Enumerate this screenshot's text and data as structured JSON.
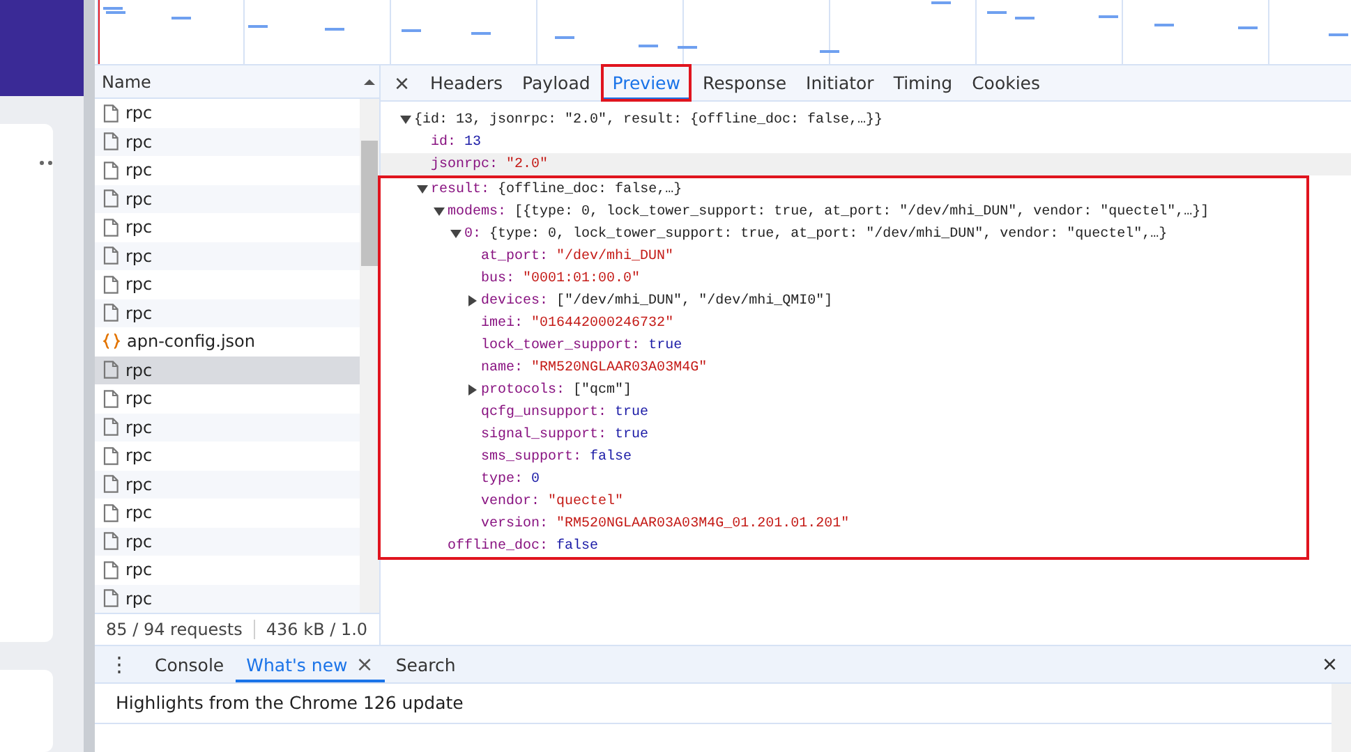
{
  "requests": {
    "column": "Name",
    "rows": [
      {
        "name": "rpc",
        "kind": "doc",
        "selected": false
      },
      {
        "name": "rpc",
        "kind": "doc",
        "selected": false
      },
      {
        "name": "rpc",
        "kind": "doc",
        "selected": false
      },
      {
        "name": "rpc",
        "kind": "doc",
        "selected": false
      },
      {
        "name": "rpc",
        "kind": "doc",
        "selected": false
      },
      {
        "name": "rpc",
        "kind": "doc",
        "selected": false
      },
      {
        "name": "rpc",
        "kind": "doc",
        "selected": false
      },
      {
        "name": "rpc",
        "kind": "doc",
        "selected": false
      },
      {
        "name": "apn-config.json",
        "kind": "json",
        "selected": false
      },
      {
        "name": "rpc",
        "kind": "doc",
        "selected": true
      },
      {
        "name": "rpc",
        "kind": "doc",
        "selected": false
      },
      {
        "name": "rpc",
        "kind": "doc",
        "selected": false
      },
      {
        "name": "rpc",
        "kind": "doc",
        "selected": false
      },
      {
        "name": "rpc",
        "kind": "doc",
        "selected": false
      },
      {
        "name": "rpc",
        "kind": "doc",
        "selected": false
      },
      {
        "name": "rpc",
        "kind": "doc",
        "selected": false
      },
      {
        "name": "rpc",
        "kind": "doc",
        "selected": false
      },
      {
        "name": "rpc",
        "kind": "doc",
        "selected": false
      }
    ],
    "status": [
      "85 / 94 requests",
      "436 kB / 1.0"
    ]
  },
  "detail": {
    "close": "×",
    "separator": ":",
    "tabs": [
      {
        "label": "Headers",
        "selected": false,
        "outlined": false
      },
      {
        "label": "Payload",
        "selected": false,
        "outlined": false
      },
      {
        "label": "Preview",
        "selected": true,
        "outlined": true
      },
      {
        "label": "Response",
        "selected": false,
        "outlined": false
      },
      {
        "label": "Initiator",
        "selected": false,
        "outlined": false
      },
      {
        "label": "Timing",
        "selected": false,
        "outlined": false
      },
      {
        "label": "Cookies",
        "selected": false,
        "outlined": false
      }
    ],
    "tree": {
      "kind": "object",
      "summary": "{id: 13, jsonrpc: \"2.0\", result: {offline_doc: false,…}}",
      "expanded": true,
      "children": [
        {
          "key": "id",
          "kind": "number",
          "value": "13"
        },
        {
          "key": "jsonrpc",
          "kind": "string",
          "value": "\"2.0\"",
          "hovered": true
        },
        {
          "key": "result",
          "kind": "object",
          "summary": "{offline_doc: false,…}",
          "expanded": true,
          "outlined": true,
          "children": [
            {
              "key": "modems",
              "kind": "object",
              "summary": "[{type: 0, lock_tower_support: true, at_port: \"/dev/mhi_DUN\", vendor: \"quectel\",…}]",
              "expanded": true,
              "children": [
                {
                  "key": "0",
                  "kind": "object",
                  "summary": "{type: 0, lock_tower_support: true, at_port: \"/dev/mhi_DUN\", vendor: \"quectel\",…}",
                  "expanded": true,
                  "children": [
                    {
                      "key": "at_port",
                      "kind": "string",
                      "value": "\"/dev/mhi_DUN\""
                    },
                    {
                      "key": "bus",
                      "kind": "string",
                      "value": "\"0001:01:00.0\""
                    },
                    {
                      "key": "devices",
                      "kind": "object",
                      "summary": "[\"/dev/mhi_DUN\", \"/dev/mhi_QMI0\"]",
                      "expanded": false
                    },
                    {
                      "key": "imei",
                      "kind": "string",
                      "value": "\"016442000246732\""
                    },
                    {
                      "key": "lock_tower_support",
                      "kind": "bool",
                      "value": "true"
                    },
                    {
                      "key": "name",
                      "kind": "string",
                      "value": "\"RM520NGLAAR03A03M4G\""
                    },
                    {
                      "key": "protocols",
                      "kind": "object",
                      "summary": "[\"qcm\"]",
                      "expanded": false
                    },
                    {
                      "key": "qcfg_unsupport",
                      "kind": "bool",
                      "value": "true"
                    },
                    {
                      "key": "signal_support",
                      "kind": "bool",
                      "value": "true"
                    },
                    {
                      "key": "sms_support",
                      "kind": "bool",
                      "value": "false"
                    },
                    {
                      "key": "type",
                      "kind": "number",
                      "value": "0"
                    },
                    {
                      "key": "vendor",
                      "kind": "string",
                      "value": "\"quectel\""
                    },
                    {
                      "key": "version",
                      "kind": "string",
                      "value": "\"RM520NGLAAR03A03M4G_01.201.01.201\""
                    }
                  ]
                }
              ]
            },
            {
              "key": "offline_doc",
              "kind": "bool",
              "value": "false"
            }
          ]
        }
      ]
    }
  },
  "drawer": {
    "menu": "⋮",
    "tabs": [
      {
        "label": "Console",
        "selected": false,
        "closable": false
      },
      {
        "label": "What's new",
        "selected": true,
        "closable": true
      },
      {
        "label": "Search",
        "selected": false,
        "closable": false
      }
    ],
    "tab_close": "×",
    "close": "×",
    "content": "Highlights from the Chrome 126 update"
  }
}
